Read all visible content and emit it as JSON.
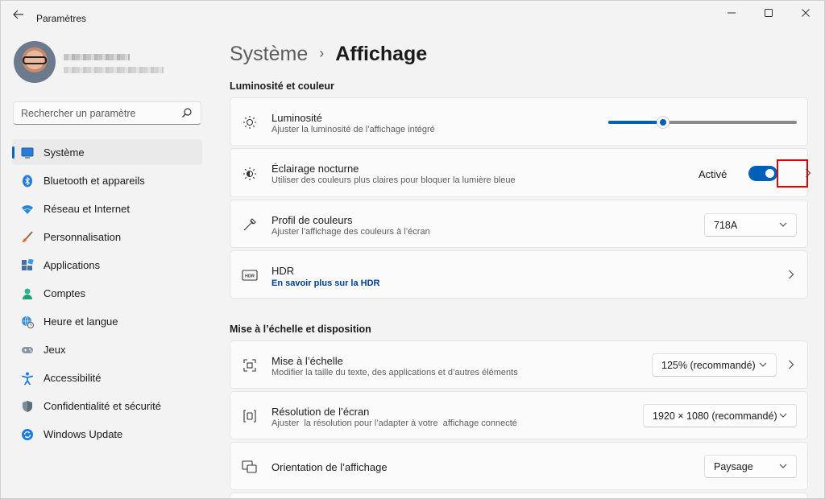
{
  "window": {
    "title": "Paramètres",
    "back_icon": "arrow-left-icon",
    "controls": [
      "minimize-icon",
      "maximize-icon",
      "close-icon"
    ]
  },
  "search": {
    "placeholder": "Rechercher un paramètre"
  },
  "sidebar": {
    "items": [
      {
        "label": "Système",
        "icon": "monitor-icon",
        "selected": true
      },
      {
        "label": "Bluetooth et appareils",
        "icon": "bluetooth-icon"
      },
      {
        "label": "Réseau et Internet",
        "icon": "wifi-icon"
      },
      {
        "label": "Personnalisation",
        "icon": "brush-icon"
      },
      {
        "label": "Applications",
        "icon": "apps-icon"
      },
      {
        "label": "Comptes",
        "icon": "person-icon"
      },
      {
        "label": "Heure et langue",
        "icon": "globe-clock-icon"
      },
      {
        "label": "Jeux",
        "icon": "gamepad-icon"
      },
      {
        "label": "Accessibilité",
        "icon": "accessibility-icon"
      },
      {
        "label": "Confidentialité et sécurité",
        "icon": "shield-icon"
      },
      {
        "label": "Windows Update",
        "icon": "update-icon"
      }
    ]
  },
  "header": {
    "parent": "Système",
    "separator": "›",
    "current": "Affichage"
  },
  "sections": {
    "brightness_color": "Luminosité et couleur",
    "scale_layout": "Mise à l’échelle et disposition"
  },
  "cards": {
    "brightness": {
      "title": "Luminosité",
      "subtitle": "Ajuster la luminosité de l’affichage intégré",
      "slider_fraction": 0.29
    },
    "night_light": {
      "title": "Éclairage nocturne",
      "subtitle": "Utiliser des couleurs plus claires pour bloquer la lumière bleue",
      "state_label": "Activé",
      "on": true
    },
    "color_profile": {
      "title": "Profil de couleurs",
      "subtitle": "Ajuster l’affichage des couleurs à l’écran",
      "value": "718A"
    },
    "hdr": {
      "title": "HDR",
      "link": "En savoir plus sur la HDR"
    },
    "scale": {
      "title": "Mise à l’échelle",
      "subtitle": "Modifier la taille du texte, des applications et d’autres éléments",
      "value": "125% (recommandé)"
    },
    "resolution": {
      "title": "Résolution de l’écran",
      "subtitle": "Ajuster  la résolution pour l’adapter à votre  affichage connecté",
      "value": "1920 × 1080 (recommandé)"
    },
    "orientation": {
      "title": "Orientation de l’affichage",
      "value": "Paysage"
    }
  },
  "colors": {
    "accent": "#005fb8",
    "highlight_box": "#e00000"
  }
}
